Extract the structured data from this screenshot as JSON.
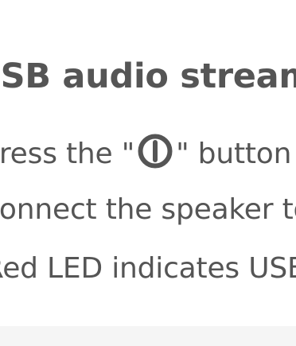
{
  "heading": "USB audio streaming",
  "instructions": {
    "line1_before": "Press the \"",
    "line1_icon": "power-icon",
    "line1_after": "\" button",
    "line2": "Connect the speaker to",
    "line3": "Red LED indicates USB"
  },
  "colors": {
    "text": "#555555",
    "background": "#ffffff"
  }
}
